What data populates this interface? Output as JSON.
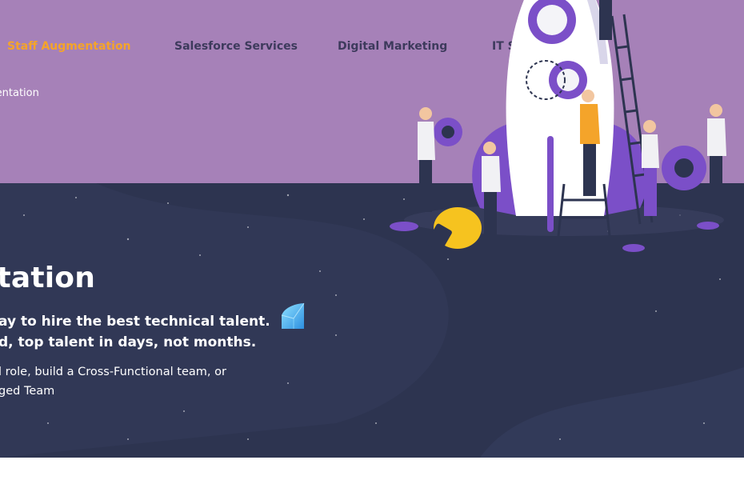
{
  "nav": {
    "items": [
      {
        "label": "Staff Augmentation",
        "active": true
      },
      {
        "label": "Salesforce Services",
        "active": false
      },
      {
        "label": "Digital Marketing",
        "active": false
      },
      {
        "label": "IT Service",
        "active": false
      }
    ]
  },
  "breadcrumb": {
    "current": "mentation"
  },
  "hero": {
    "title": "entation",
    "subtitle_line1": "ay to hire the best technical talent.",
    "subtitle_line2": "d, top talent in days, not months.",
    "body_line1": "l role, build a Cross-Functional team, or",
    "body_line2": "ged Team"
  },
  "colors": {
    "header_bg": "#a681b8",
    "hero_bg": "#2d3450",
    "nav_active": "#f4a42a",
    "nav_text": "#3d3a5c",
    "accent_purple": "#7b4fc8",
    "accent_orange": "#f4a42a"
  },
  "icons": {
    "gem": "gem-icon",
    "illustration": "rocket-team-illustration"
  }
}
